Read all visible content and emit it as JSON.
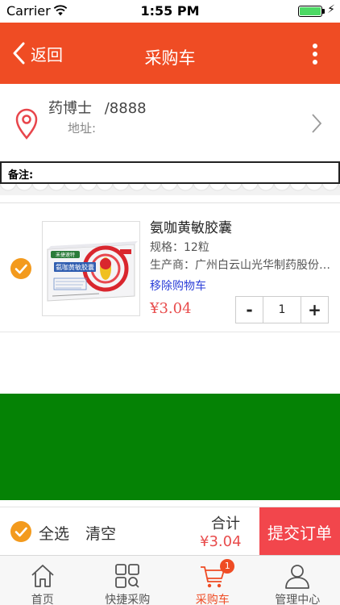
{
  "status_bar": {
    "carrier": "Carrier",
    "time": "1:55 PM",
    "battery_level_percent": 100
  },
  "nav": {
    "back_label": "返回",
    "title": "采购车"
  },
  "address": {
    "name": "药博士",
    "phone": "/8888",
    "address_label": "地址:"
  },
  "remark": {
    "label": "备注:",
    "value": ""
  },
  "cart_item": {
    "product_name": "氨咖黄敏胶囊",
    "spec": "规格：12粒",
    "manufacturer": "生产商：广州白云山光华制药股份有限公司",
    "remove_label": "移除购物车",
    "price": "¥3.04",
    "quantity": "1",
    "minus_label": "-",
    "plus_label": "+",
    "package_brand": "禾捷速特",
    "package_name": "氨咖黄敏胶囊",
    "selected": true
  },
  "bottom_bar": {
    "select_all_label": "全选",
    "clear_label": "清空",
    "total_label": "合计",
    "total_value": "¥3.04",
    "submit_label": "提交订单"
  },
  "tabs": [
    {
      "label": "首页",
      "icon": "home-icon"
    },
    {
      "label": "快捷采购",
      "icon": "grid-search-icon"
    },
    {
      "label": "采购车",
      "icon": "cart-icon",
      "badge": "1",
      "active": true
    },
    {
      "label": "管理中心",
      "icon": "user-icon"
    }
  ],
  "colors": {
    "brand": "#ef4c24",
    "check": "#f39a1d",
    "price": "#e84c4c",
    "link": "#2c3fd8",
    "banner": "#058205",
    "submit": "#f2464c"
  }
}
